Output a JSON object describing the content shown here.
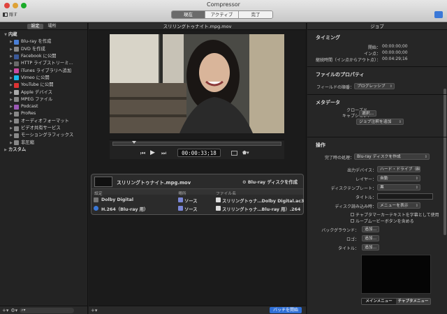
{
  "app_title": "Compressor",
  "toolbar": {
    "hide_label": "隠す",
    "segments": [
      "現在",
      "アクティブ",
      "完了"
    ]
  },
  "left": {
    "tabs": [
      "設定",
      "場所"
    ],
    "items": [
      {
        "label": "内蔵",
        "level": 0,
        "color": "#888",
        "icon": "disclosure-open-icon"
      },
      {
        "label": "Blu-ray を作成",
        "level": 1,
        "color": "#4a7fd6",
        "icon": "blu-ray-icon"
      },
      {
        "label": "DVD を作成",
        "level": 1,
        "color": "#8a8a8a",
        "icon": "dvd-icon"
      },
      {
        "label": "Facebook に公開",
        "level": 1,
        "color": "#3b5998",
        "icon": "facebook-icon"
      },
      {
        "label": "HTTP ライブストリーミ…",
        "level": 1,
        "color": "#6a6a6a",
        "icon": "http-icon"
      },
      {
        "label": "iTunes ライブラリへ追加",
        "level": 1,
        "color": "#c84aa0",
        "icon": "itunes-icon"
      },
      {
        "label": "Vimeo に公開",
        "level": 1,
        "color": "#1ab7ea",
        "icon": "vimeo-icon"
      },
      {
        "label": "YouTube に公開",
        "level": 1,
        "color": "#d33",
        "icon": "youtube-icon"
      },
      {
        "label": "Apple デバイス",
        "level": 1,
        "color": "#aaa",
        "icon": "apple-device-icon"
      },
      {
        "label": "MPEG ファイル",
        "level": 1,
        "color": "#888",
        "icon": "mpeg-icon"
      },
      {
        "label": "Podcast",
        "level": 1,
        "color": "#9b59b6",
        "icon": "podcast-icon"
      },
      {
        "label": "ProRes",
        "level": 1,
        "color": "#888",
        "icon": "prores-icon"
      },
      {
        "label": "オーディオフォーマット",
        "level": 1,
        "color": "#888",
        "icon": "audio-icon"
      },
      {
        "label": "ビデオ共有サービス",
        "level": 1,
        "color": "#888",
        "icon": "video-share-icon"
      },
      {
        "label": "モーショングラフィックス",
        "level": 1,
        "color": "#888",
        "icon": "motion-graphics-icon"
      },
      {
        "label": "非圧縮",
        "level": 1,
        "color": "#888",
        "icon": "uncompressed-icon"
      },
      {
        "label": "カスタム",
        "level": 0,
        "color": "#888",
        "icon": "disclosure-closed-icon"
      }
    ]
  },
  "middle": {
    "title": "スリリングトゥナイト.mpg.mov",
    "timecode": "00:00:33;18",
    "start_batch": "バッチを開始",
    "batch": {
      "job_name": "スリリングトゥナイト.mpg.mov",
      "action": "Blu-ray ディスクを作成",
      "columns": [
        "設定",
        "場所",
        "ファイル名"
      ],
      "rows": [
        {
          "setting": "Dolby Digital",
          "location": "ソース",
          "filename": "スリリングトゥナ…Dolby Digital.ac3"
        },
        {
          "setting": "H.264（Blu-ray 用）",
          "location": "ソース",
          "filename": "スリリングトゥナ…Blu-ray 用）.264"
        }
      ]
    }
  },
  "right": {
    "title": "ジョブ",
    "timing": {
      "header": "タイミング",
      "start_label": "開始：",
      "start": "00:00:00;00",
      "in_label": "イン点：",
      "in": "00:00:00;00",
      "dur_label": "継続時間（イン点からアウト点）：",
      "dur": "00:04:29;16"
    },
    "file_props": {
      "header": "ファイルのプロパティ",
      "field_label": "フィールドの順番：",
      "field_value": "プログレッシブ"
    },
    "metadata": {
      "header": "メタデータ",
      "cc_label": "クローズド\nキャプション：",
      "cc_button": "選択...",
      "job_note": "ジョブ注釈を追加"
    },
    "action": {
      "header": "操作",
      "done_label": "完了時の処理：",
      "done_value": "Blu-ray ディスクを作成",
      "device_label": "出力デバイス：",
      "device_value": "ハード・ドライブ（Blu-…",
      "layer_label": "レイヤー：",
      "layer_value": "自動",
      "template_label": "ディスクテンプレート：",
      "template_value": "黒",
      "title_label": "タイトル：",
      "title_value": "",
      "load_label": "ディスク読み込み時：",
      "load_value": "メニューを表示",
      "chapter_check": "チャプタマーカーテキストを字幕として使用",
      "loop_check": "ループムービーボタンを含める",
      "bg_label": "バックグラウンド：",
      "logo_label": "ロゴ：",
      "title2_label": "タイトル：",
      "add": "追加...",
      "tabs": [
        "メインメニュー",
        "チャプタメニュー"
      ]
    }
  }
}
